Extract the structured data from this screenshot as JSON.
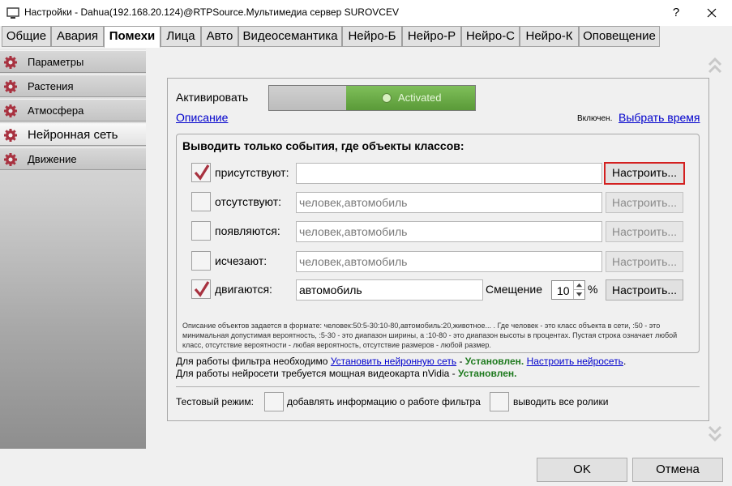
{
  "window": {
    "title": "Настройки - Dahua(192.168.20.124)@RTPSource.Мультимедиа сервер SUROVCEV",
    "help": "?"
  },
  "tabs": [
    {
      "label": "Общие"
    },
    {
      "label": "Авария"
    },
    {
      "label": "Помехи",
      "active": true
    },
    {
      "label": "Лица"
    },
    {
      "label": "Авто"
    },
    {
      "label": "Видеосемантика"
    },
    {
      "label": "Нейро-Б"
    },
    {
      "label": "Нейро-Р"
    },
    {
      "label": "Нейро-С"
    },
    {
      "label": "Нейро-К"
    },
    {
      "label": "Оповещение"
    }
  ],
  "sidebar": {
    "items": [
      {
        "label": "Параметры",
        "icon": "gear-icon"
      },
      {
        "label": "Растения",
        "icon": "gear-icon"
      },
      {
        "label": "Атмосфера",
        "icon": "gear-icon"
      },
      {
        "label": "Нейронная сеть",
        "icon": "gear-icon",
        "active": true
      },
      {
        "label": "Движение",
        "icon": "gear-icon"
      }
    ]
  },
  "main": {
    "activate_label": "Активировать",
    "toggle_state": "Activated",
    "description_link": "Описание",
    "enabled_text": "Включен.",
    "select_time_link": "Выбрать время",
    "group_title": "Выводить только события, где объекты классов:",
    "rows": [
      {
        "label": "присутствуют:",
        "checked": true,
        "value": "",
        "button": "Настроить..."
      },
      {
        "label": "отсутствуют:",
        "checked": false,
        "value": "человек,автомобиль",
        "button": "Настроить..."
      },
      {
        "label": "появляются:",
        "checked": false,
        "value": "человек,автомобиль",
        "button": "Настроить..."
      },
      {
        "label": "исчезают:",
        "checked": false,
        "value": "человек,автомобиль",
        "button": "Настроить..."
      },
      {
        "label": "двигаются:",
        "checked": true,
        "value": "автомобиль",
        "button": "Настроить..."
      }
    ],
    "offset_label": "Смещение",
    "offset_value": "10",
    "offset_unit": "%",
    "description_text": "Описание объектов задается в формате: человек:50:5-30:10-80,автомобиль:20,животное... . Где человек - это класс объекта в сети, :50 - это минимальная допустимая вероятность, :5-30 - это диапазон ширины, а :10-80 - это диапазон высоты в процентах. Пустая строка означает любой класс, отсутствие вероятности - любая вероятность, отсутствие размеров - любой размер.",
    "filter_note_prefix": "Для работы фильтра необходимо",
    "install_nn_link": "Установить нейронную сеть",
    "installed_text": "Установлен.",
    "configure_nn_link": "Настроить нейросеть",
    "gpu_note": "Для работы нейросети требуется мощная видеокарта nVidia -",
    "test_mode_label": "Тестовый режим:",
    "test_option_1": "добавлять информацию о работе фильтра",
    "test_option_2": "выводить все ролики"
  },
  "dialog": {
    "ok": "OK",
    "cancel": "Отмена"
  },
  "colors": {
    "accent_green": "#6aaa48",
    "focus_red": "#d32020",
    "status_green": "#1e7a1e",
    "link_blue": "#0000cc",
    "icon_red": "#a83240"
  }
}
